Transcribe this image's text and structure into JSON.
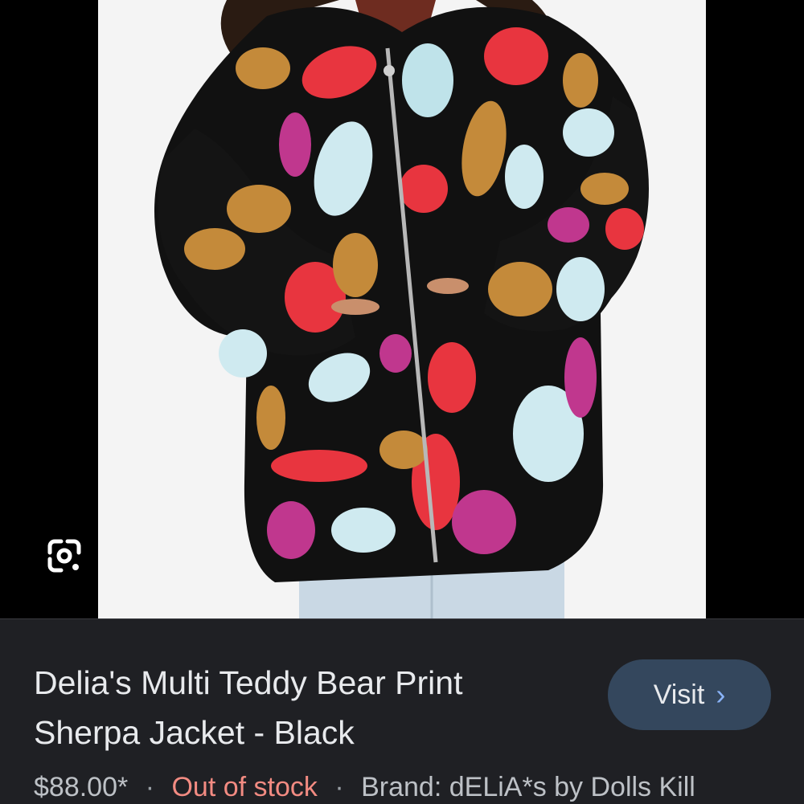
{
  "product": {
    "title_line1": "Delia's Multi Teddy Bear Print",
    "title_line2": "Sherpa Jacket - Black",
    "price": "$88.00*",
    "separator": "·",
    "stock_status": "Out of stock",
    "brand": "Brand: dELiA*s by Dolls Kill"
  },
  "actions": {
    "visit_label": "Visit",
    "visit_chevron": "›",
    "lens_icon": "google-lens-icon"
  },
  "colors": {
    "panel_bg": "#1f2024",
    "visit_bg": "#34475d",
    "out_of_stock": "#f28b82",
    "chevron": "#8ab4f8"
  },
  "image": {
    "subject": "teddy-bear-print-sherpa-jacket"
  }
}
